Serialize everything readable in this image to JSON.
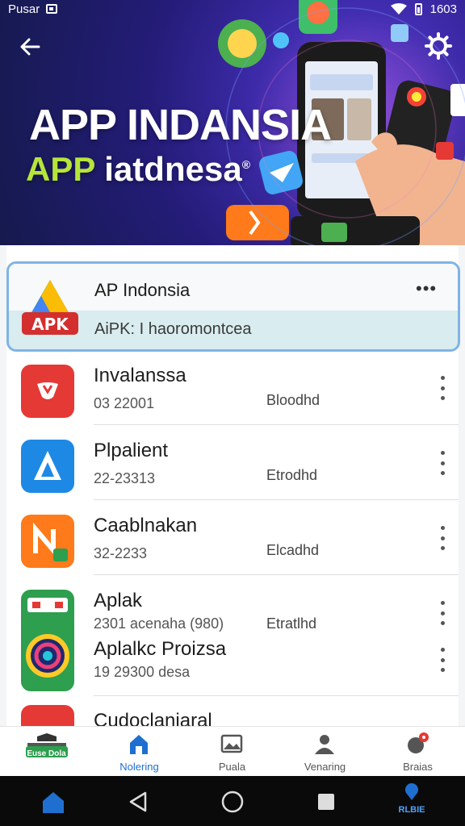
{
  "status_bar": {
    "left_text": "Pusar",
    "time": "1603"
  },
  "hero": {
    "title": "APP INDANSIA",
    "subtitle_highlight": "APP",
    "subtitle_rest": " iatdnesa",
    "subtitle_mark": "®"
  },
  "featured": {
    "logo_text": "APK",
    "title": "AP Indonsia",
    "subtitle": "AiPK: I haoromontcea",
    "more": "•••"
  },
  "apps": [
    {
      "title": "Invalanssa",
      "subtitle": "03 22001",
      "status": "Bloodhd",
      "icon": "red-heart-icon",
      "color": "#e53935"
    },
    {
      "title": "Plpalient",
      "subtitle": "22-23313",
      "status": "Etrodhd",
      "icon": "blue-a-icon",
      "color": "#1e88e5"
    },
    {
      "title": "Caablnakan",
      "subtitle": "32-2233",
      "status": "Elcadhd",
      "icon": "orange-n-icon",
      "color": "#ff7a1a"
    },
    {
      "title": "Aplak",
      "subtitle": "2301 acenaha (980)",
      "status": "Etratlhd",
      "icon": "green-circle-icon",
      "color": "#2e9e4f"
    },
    {
      "title": "Aplalkc Proizsa",
      "subtitle": "19 29300 desa",
      "status": "",
      "icon": "green-circle-icon",
      "color": "#2e9e4f"
    },
    {
      "title": "Cudoclaniaral",
      "subtitle": "",
      "status": "",
      "icon": "red-partial-icon",
      "color": "#e53935"
    }
  ],
  "bottom_nav": [
    {
      "label": "Euse Dola",
      "icon": "store-icon"
    },
    {
      "label": "Nolering",
      "icon": "home-icon"
    },
    {
      "label": "Puala",
      "icon": "image-icon"
    },
    {
      "label": "Venaring",
      "icon": "user-icon"
    },
    {
      "label": "Braias",
      "icon": "chat-bell-icon"
    }
  ],
  "system_nav": {
    "right_label": "RLBIE"
  },
  "colors": {
    "accent": "#1f6fd1",
    "hero_bg": "#241c78",
    "featured_border": "#7fb4e4"
  }
}
